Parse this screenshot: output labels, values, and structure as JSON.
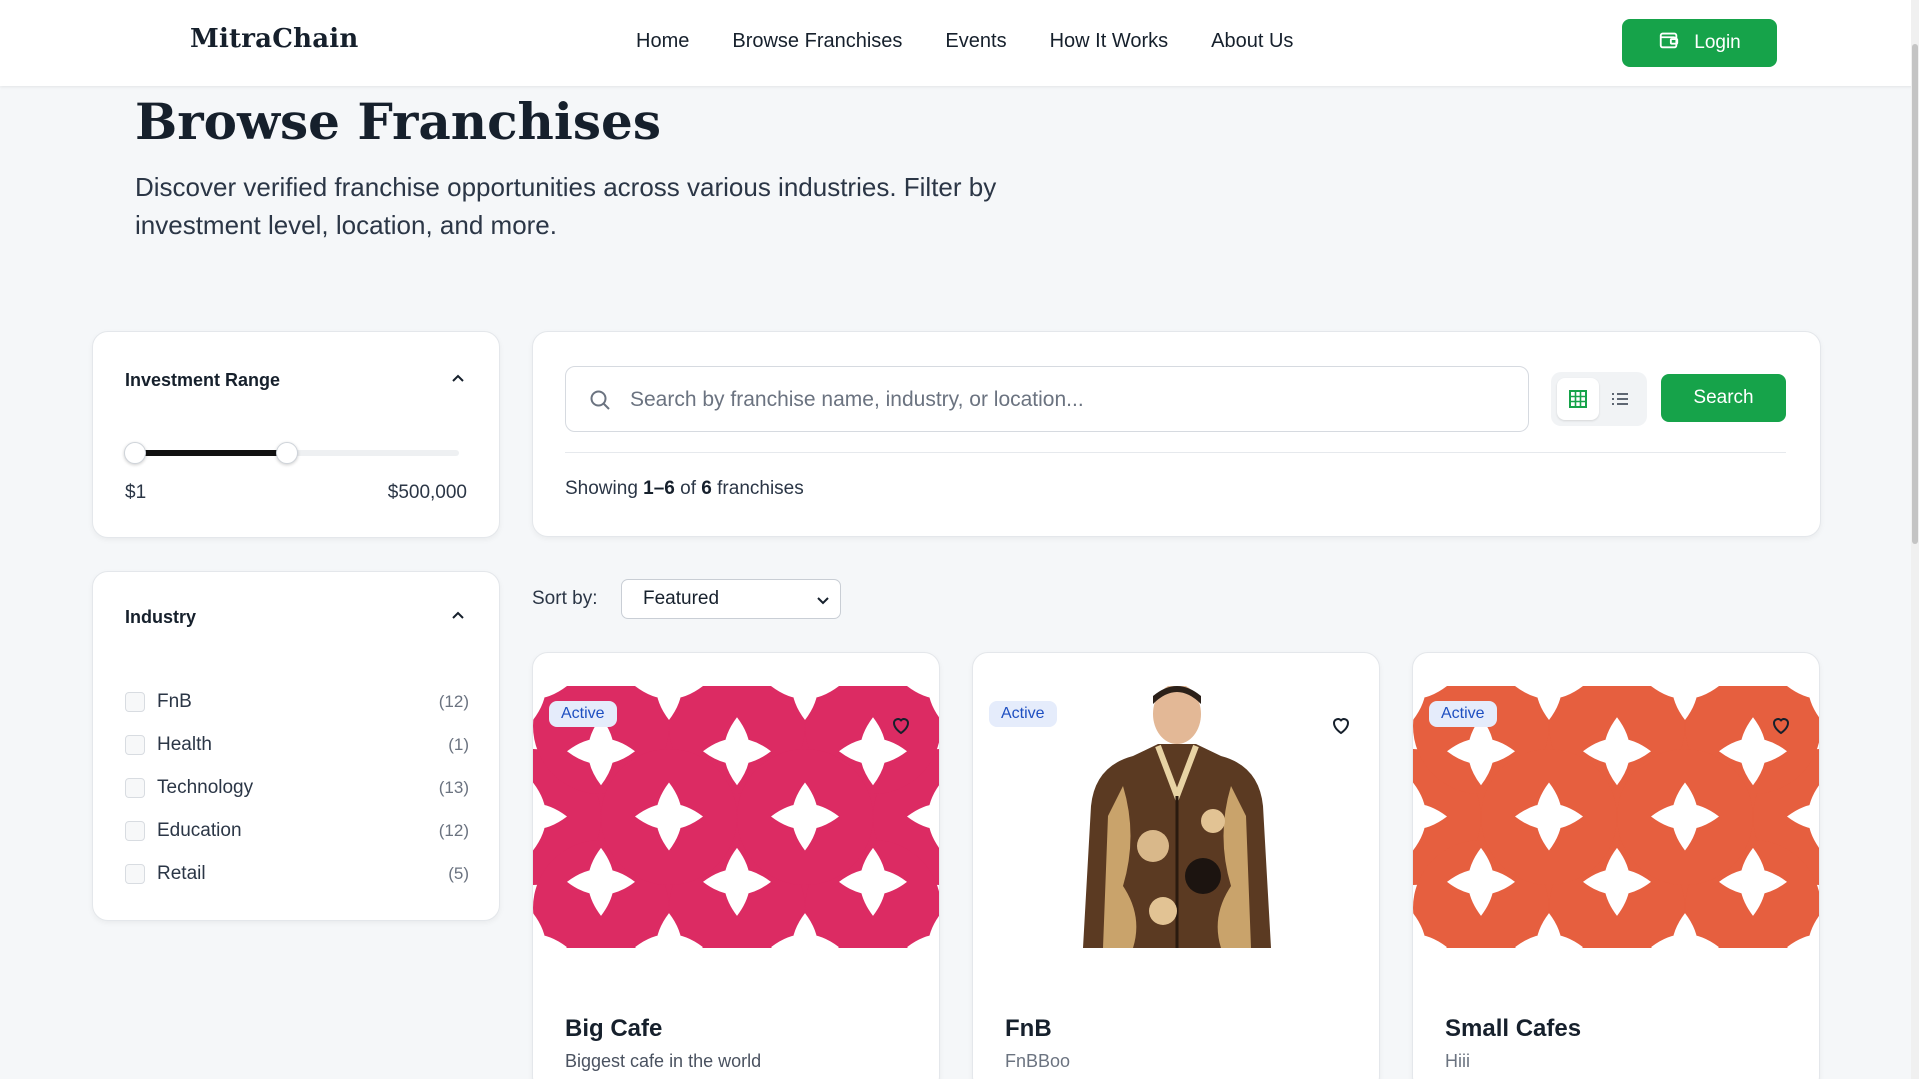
{
  "header": {
    "brand": "MitraChain",
    "nav": [
      "Home",
      "Browse Franchises",
      "Events",
      "How It Works",
      "About Us"
    ],
    "login_label": "Login"
  },
  "hero": {
    "title": "Browse Franchises",
    "subtitle": "Discover verified franchise opportunities across various industries. Filter by investment level, location, and more."
  },
  "filters": {
    "investment": {
      "title": "Investment Range",
      "min_label": "$1",
      "max_label": "$500,000",
      "selected_fraction": [
        0,
        0.47
      ]
    },
    "industry": {
      "title": "Industry",
      "items": [
        {
          "name": "FnB",
          "count": "(12)"
        },
        {
          "name": "Health",
          "count": "(1)"
        },
        {
          "name": "Technology",
          "count": "(13)"
        },
        {
          "name": "Education",
          "count": "(12)"
        },
        {
          "name": "Retail",
          "count": "(5)"
        }
      ]
    }
  },
  "search": {
    "placeholder": "Search by franchise name, industry, or location...",
    "button": "Search",
    "showing_prefix": "Showing",
    "showing_range": "1–6",
    "showing_of": "of",
    "showing_total": "6",
    "showing_suffix": "franchises"
  },
  "sort": {
    "label": "Sort by:",
    "selected": "Featured"
  },
  "franchises": [
    {
      "badge": "Active",
      "name": "Big Cafe",
      "description": "Biggest cafe in the world",
      "pattern_color": "#dc2b63"
    },
    {
      "badge": "Active",
      "name": "FnB",
      "description": "FnBBoo",
      "pattern_color": ""
    },
    {
      "badge": "Active",
      "name": "Small Cafes",
      "description": "Hiii",
      "pattern_color": "#e65f3f"
    }
  ],
  "colors": {
    "accent": "#16a34a",
    "badge_bg": "#e5ecfb",
    "badge_text": "#1e4fc1"
  }
}
